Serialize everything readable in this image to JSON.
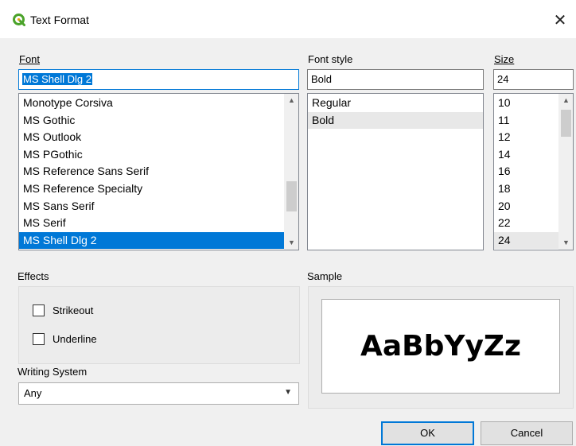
{
  "window": {
    "title": "Text Format",
    "close_glyph": "✕"
  },
  "font": {
    "label": "Font",
    "value": "MS Shell Dlg 2",
    "items": [
      "Monotype Corsiva",
      "MS Gothic",
      "MS Outlook",
      "MS PGothic",
      "MS Reference Sans Serif",
      "MS Reference Specialty",
      "MS Sans Serif",
      "MS Serif",
      "MS Shell Dlg 2"
    ],
    "selected": "MS Shell Dlg 2"
  },
  "font_style": {
    "label": "Font style",
    "value": "Bold",
    "items": [
      "Regular",
      "Bold"
    ],
    "selected": "Bold"
  },
  "size": {
    "label": "Size",
    "value": "24",
    "items": [
      "10",
      "11",
      "12",
      "14",
      "16",
      "18",
      "20",
      "22",
      "24"
    ],
    "selected": "24"
  },
  "effects": {
    "label": "Effects",
    "strikeout": "Strikeout",
    "underline": "Underline",
    "strikeout_checked": false,
    "underline_checked": false
  },
  "writing_system": {
    "label": "Writing System",
    "value": "Any"
  },
  "sample": {
    "label": "Sample",
    "text": "AaBbYyZz"
  },
  "buttons": {
    "ok": "OK",
    "cancel": "Cancel"
  },
  "colors": {
    "accent": "#0078d7",
    "icon": "#4ba32a"
  }
}
